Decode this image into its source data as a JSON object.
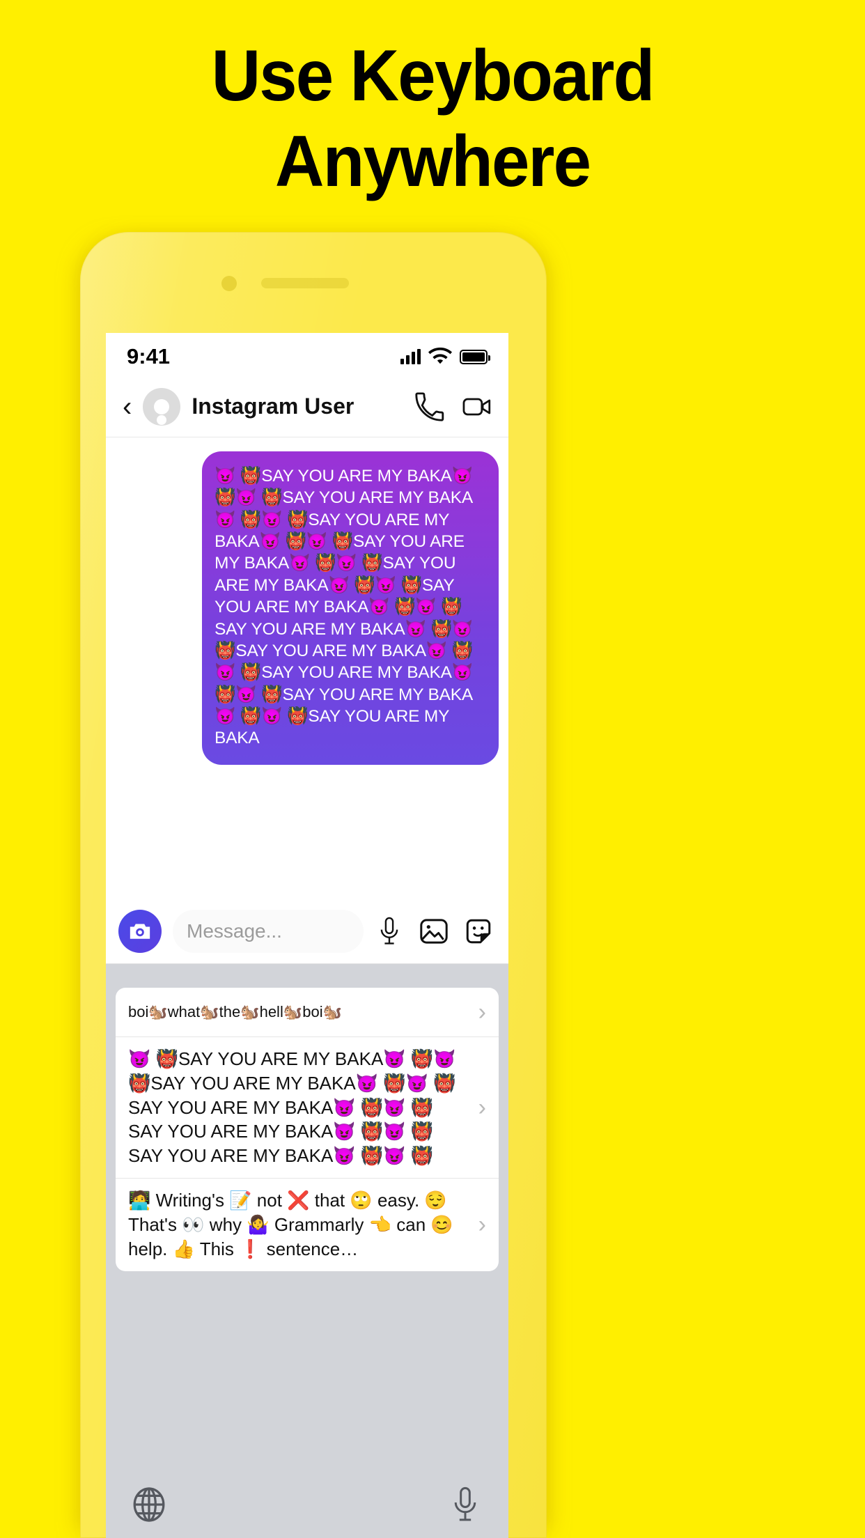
{
  "promo": {
    "headline_line1": "Use Keyboard",
    "headline_line2": "Anywhere",
    "background_color": "#FFEF00"
  },
  "status_bar": {
    "time": "9:41",
    "signal_icon": "cellular-bars-icon",
    "wifi_icon": "wifi-icon",
    "battery_icon": "battery-full-icon"
  },
  "chat_header": {
    "back_label": "‹",
    "avatar_icon": "default-avatar-icon",
    "peer_name": "Instagram User",
    "call_icon": "phone-icon",
    "video_icon": "video-camera-icon"
  },
  "conversation": {
    "bubble_color_top": "#9b32d6",
    "bubble_color_bottom": "#6a4ae2",
    "outgoing_message": "😈 👹SAY YOU ARE MY BAKA😈 👹😈 👹SAY YOU ARE MY BAKA😈 👹😈 👹SAY YOU ARE MY BAKA😈 👹😈 👹SAY YOU ARE MY BAKA😈 👹😈 👹SAY YOU ARE MY BAKA😈 👹😈 👹SAY YOU ARE MY BAKA😈 👹😈 👹SAY YOU ARE MY BAKA😈 👹😈 👹SAY YOU ARE MY BAKA😈 👹😈 👹SAY YOU ARE MY BAKA😈 👹😈 👹SAY YOU ARE MY BAKA😈 👹😈 👹SAY YOU ARE MY BAKA"
  },
  "input_bar": {
    "camera_icon": "camera-icon",
    "placeholder": "Message...",
    "mic_icon": "microphone-icon",
    "gallery_icon": "photo-gallery-icon",
    "sticker_icon": "sticker-icon"
  },
  "keyboard": {
    "background_color": "#d2d4d9",
    "suggestions": [
      {
        "id": "suggestion-boi",
        "text": "boi🐿️what🐿️the🐿️hell🐿️boi🐿️",
        "chevron": "›"
      },
      {
        "id": "suggestion-baka",
        "text": "😈 👹SAY YOU ARE MY BAKA😈 👹😈 👹SAY YOU ARE MY BAKA😈 👹😈 👹SAY YOU ARE MY BAKA😈 👹😈 👹SAY YOU ARE MY BAKA😈 👹😈 👹SAY YOU ARE MY BAKA😈 👹😈 👹",
        "chevron": "›"
      },
      {
        "id": "suggestion-grammarly",
        "text": "🧑‍💻 Writing's 📝 not ❌ that 🙄 easy. 😌 That's 👀 why 🤷‍♀️ Grammarly 👈 can 😊 help. 👍 This ❗ sentence…",
        "chevron": "›"
      }
    ],
    "globe_icon": "globe-icon",
    "dictation_icon": "microphone-icon"
  }
}
